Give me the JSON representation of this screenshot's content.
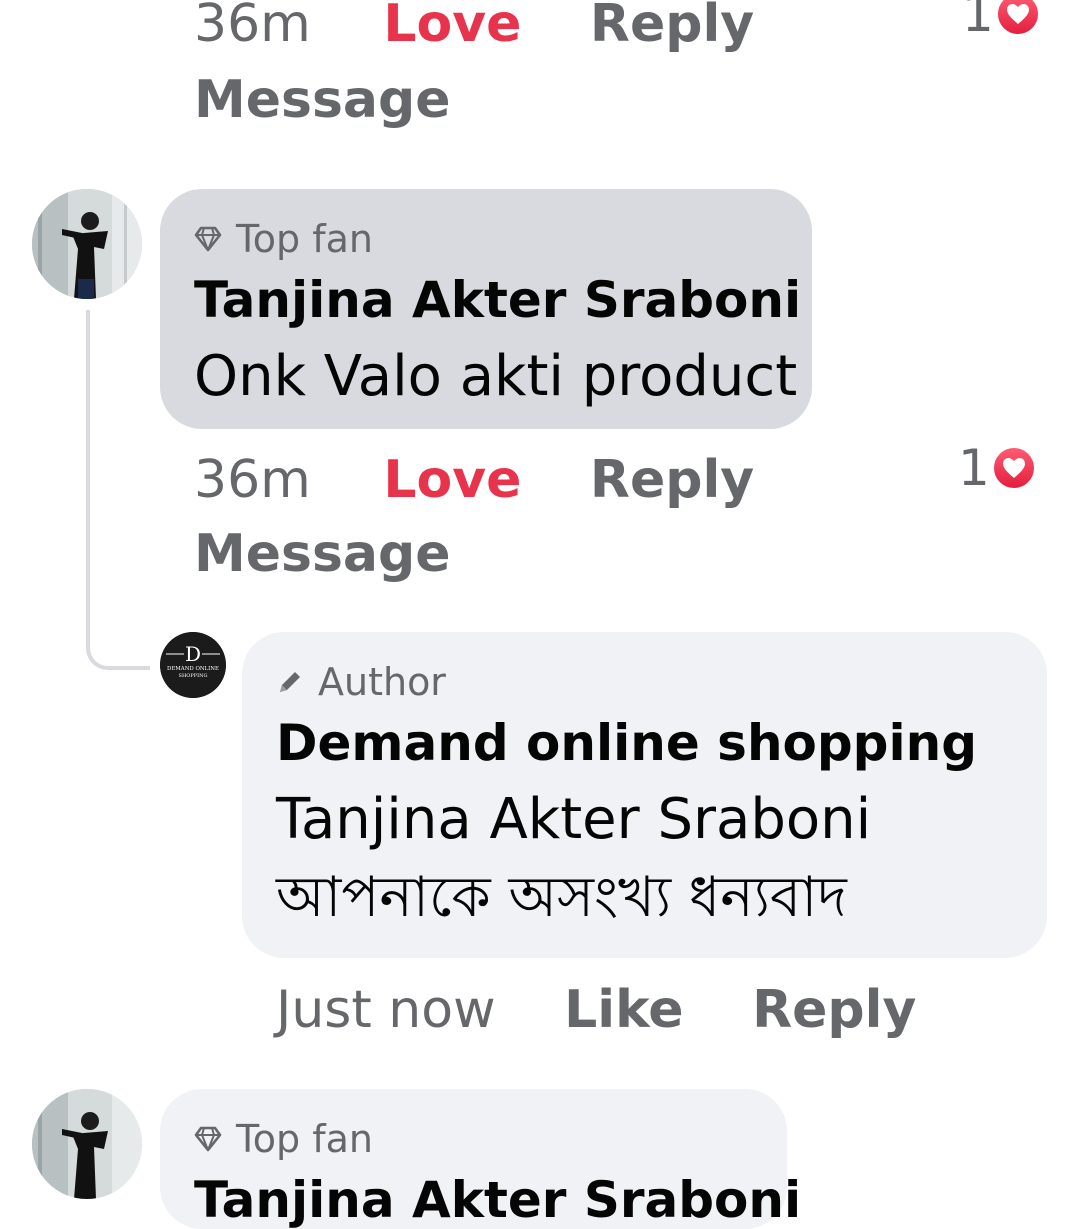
{
  "comments": [
    {
      "time": "36m",
      "love": "Love",
      "reply": "Reply",
      "message": "Message",
      "reaction_count": "1"
    },
    {
      "badge": "Top fan",
      "badge_icon": "diamond-icon",
      "name": "Tanjina Akter Sraboni",
      "text": "Onk Valo akti product",
      "time": "36m",
      "love": "Love",
      "reply": "Reply",
      "message": "Message",
      "reaction_count": "1",
      "reaction_icon": "heart-icon"
    },
    {
      "badge": "Author",
      "badge_icon": "pencil-icon",
      "name": "Demand online shopping",
      "text_line1": "Tanjina Akter Sraboni",
      "text_line2": "আপনাকে অসংখ্য ধন্যবাদ",
      "time": "Just now",
      "like": "Like",
      "reply": "Reply",
      "avatar_logo_letter": "D",
      "avatar_logo_text_1": "DEMAND ONLINE",
      "avatar_logo_text_2": "SHOPPING"
    },
    {
      "badge": "Top fan",
      "badge_icon": "diamond-icon",
      "name": "Tanjina Akter Sraboni"
    }
  ],
  "colors": {
    "love": "#e8334c",
    "muted": "#65676b",
    "bubble_selected": "#d8dadf",
    "bubble": "#f0f2f5"
  }
}
